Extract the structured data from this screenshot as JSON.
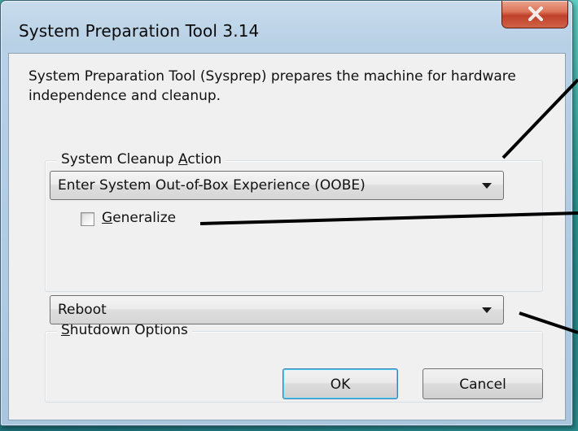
{
  "window": {
    "title": "System Preparation Tool 3.14",
    "close_glyph": "X"
  },
  "dialog": {
    "description": "System Preparation Tool (Sysprep) prepares the machine for hardware independence and cleanup."
  },
  "cleanup": {
    "label_pre": "System Cleanup ",
    "label_accel": "A",
    "label_post": "ction",
    "selected": "Enter System Out-of-Box Experience (OOBE)",
    "generalize": {
      "label_accel": "G",
      "label_post": "eneralize",
      "checked": false
    }
  },
  "shutdown": {
    "label_accel": "S",
    "label_post": "hutdown Options",
    "selected": "Reboot"
  },
  "buttons": {
    "ok_label": "OK",
    "cancel_label": "Cancel"
  },
  "colors": {
    "desktop": "#2f8a8c",
    "frame": "#b9d1e6",
    "client": "#f0f0f0",
    "close_button": "#c0402a",
    "default_button_focus": "#48d0f6"
  }
}
